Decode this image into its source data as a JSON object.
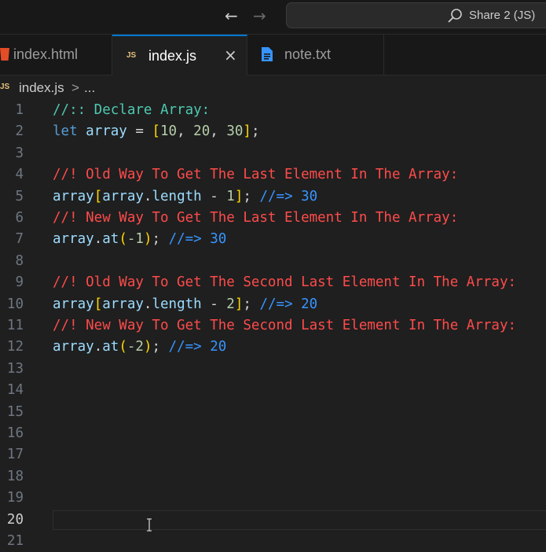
{
  "titlebar": {
    "back_icon": "arrow-left-icon",
    "forward_icon": "arrow-right-icon",
    "command_center_text": "Share 2 (JS)",
    "search_icon": "search-icon"
  },
  "tabs": [
    {
      "label": "index.html",
      "icon": "html-file-icon",
      "active": false
    },
    {
      "label": "index.js",
      "icon": "js-file-icon",
      "active": true
    },
    {
      "label": "note.txt",
      "icon": "text-file-icon",
      "active": false
    }
  ],
  "tab_close_glyph": "×",
  "tab_js_icon_text": "JS",
  "breadcrumb": {
    "icon_text": "JS",
    "file": "index.js",
    "separator": ">",
    "more": "..."
  },
  "editor": {
    "current_line": 20,
    "line_numbers": [
      "1",
      "2",
      "3",
      "4",
      "5",
      "6",
      "7",
      "8",
      "9",
      "10",
      "11",
      "12",
      "13",
      "14",
      "15",
      "16",
      "17",
      "18",
      "19",
      "20",
      "21"
    ],
    "lines": [
      {
        "segments": [
          {
            "t": "//:: Declare Array:",
            "c": "c-doc"
          }
        ]
      },
      {
        "segments": [
          {
            "t": "let",
            "c": "kw"
          },
          {
            "t": " ",
            "c": "punc"
          },
          {
            "t": "array",
            "c": "var"
          },
          {
            "t": " = ",
            "c": "punc"
          },
          {
            "t": "[",
            "c": "br1"
          },
          {
            "t": "10",
            "c": "num"
          },
          {
            "t": ", ",
            "c": "punc"
          },
          {
            "t": "20",
            "c": "num"
          },
          {
            "t": ", ",
            "c": "punc"
          },
          {
            "t": "30",
            "c": "num"
          },
          {
            "t": "]",
            "c": "br1"
          },
          {
            "t": ";",
            "c": "punc"
          }
        ]
      },
      {
        "segments": []
      },
      {
        "segments": [
          {
            "t": "//! Old Way To Get The Last Element In The Array:",
            "c": "c-red"
          }
        ]
      },
      {
        "segments": [
          {
            "t": "array",
            "c": "var"
          },
          {
            "t": "[",
            "c": "br1"
          },
          {
            "t": "array",
            "c": "var"
          },
          {
            "t": ".",
            "c": "punc"
          },
          {
            "t": "length",
            "c": "var"
          },
          {
            "t": " - ",
            "c": "punc"
          },
          {
            "t": "1",
            "c": "num"
          },
          {
            "t": "]",
            "c": "br1"
          },
          {
            "t": "; ",
            "c": "punc"
          },
          {
            "t": "//=> 30",
            "c": "c-blue"
          }
        ]
      },
      {
        "segments": [
          {
            "t": "//! New Way To Get The Last Element In The Array:",
            "c": "c-red"
          }
        ]
      },
      {
        "segments": [
          {
            "t": "array",
            "c": "var"
          },
          {
            "t": ".",
            "c": "punc"
          },
          {
            "t": "at",
            "c": "var"
          },
          {
            "t": "(",
            "c": "br1"
          },
          {
            "t": "-1",
            "c": "num"
          },
          {
            "t": ")",
            "c": "br1"
          },
          {
            "t": "; ",
            "c": "punc"
          },
          {
            "t": "//=> 30",
            "c": "c-blue"
          }
        ]
      },
      {
        "segments": []
      },
      {
        "segments": [
          {
            "t": "//! Old Way To Get The Second Last Element In The Array:",
            "c": "c-red"
          }
        ]
      },
      {
        "segments": [
          {
            "t": "array",
            "c": "var"
          },
          {
            "t": "[",
            "c": "br1"
          },
          {
            "t": "array",
            "c": "var"
          },
          {
            "t": ".",
            "c": "punc"
          },
          {
            "t": "length",
            "c": "var"
          },
          {
            "t": " - ",
            "c": "punc"
          },
          {
            "t": "2",
            "c": "num"
          },
          {
            "t": "]",
            "c": "br1"
          },
          {
            "t": "; ",
            "c": "punc"
          },
          {
            "t": "//=> 20",
            "c": "c-blue"
          }
        ]
      },
      {
        "segments": [
          {
            "t": "//! New Way To Get The Second Last Element In The Array:",
            "c": "c-red"
          }
        ]
      },
      {
        "segments": [
          {
            "t": "array",
            "c": "var"
          },
          {
            "t": ".",
            "c": "punc"
          },
          {
            "t": "at",
            "c": "var"
          },
          {
            "t": "(",
            "c": "br1"
          },
          {
            "t": "-2",
            "c": "num"
          },
          {
            "t": ")",
            "c": "br1"
          },
          {
            "t": "; ",
            "c": "punc"
          },
          {
            "t": "//=> 20",
            "c": "c-blue"
          }
        ]
      },
      {
        "segments": []
      },
      {
        "segments": []
      },
      {
        "segments": []
      },
      {
        "segments": []
      },
      {
        "segments": []
      },
      {
        "segments": []
      },
      {
        "segments": []
      },
      {
        "segments": []
      },
      {
        "segments": []
      }
    ]
  },
  "colors": {
    "accent": "#0078d4",
    "comment_red": "#ff4b4b",
    "comment_teal": "#4ec9b0",
    "comment_blue": "#3794ff"
  },
  "mouse_icon": "text-cursor-icon"
}
